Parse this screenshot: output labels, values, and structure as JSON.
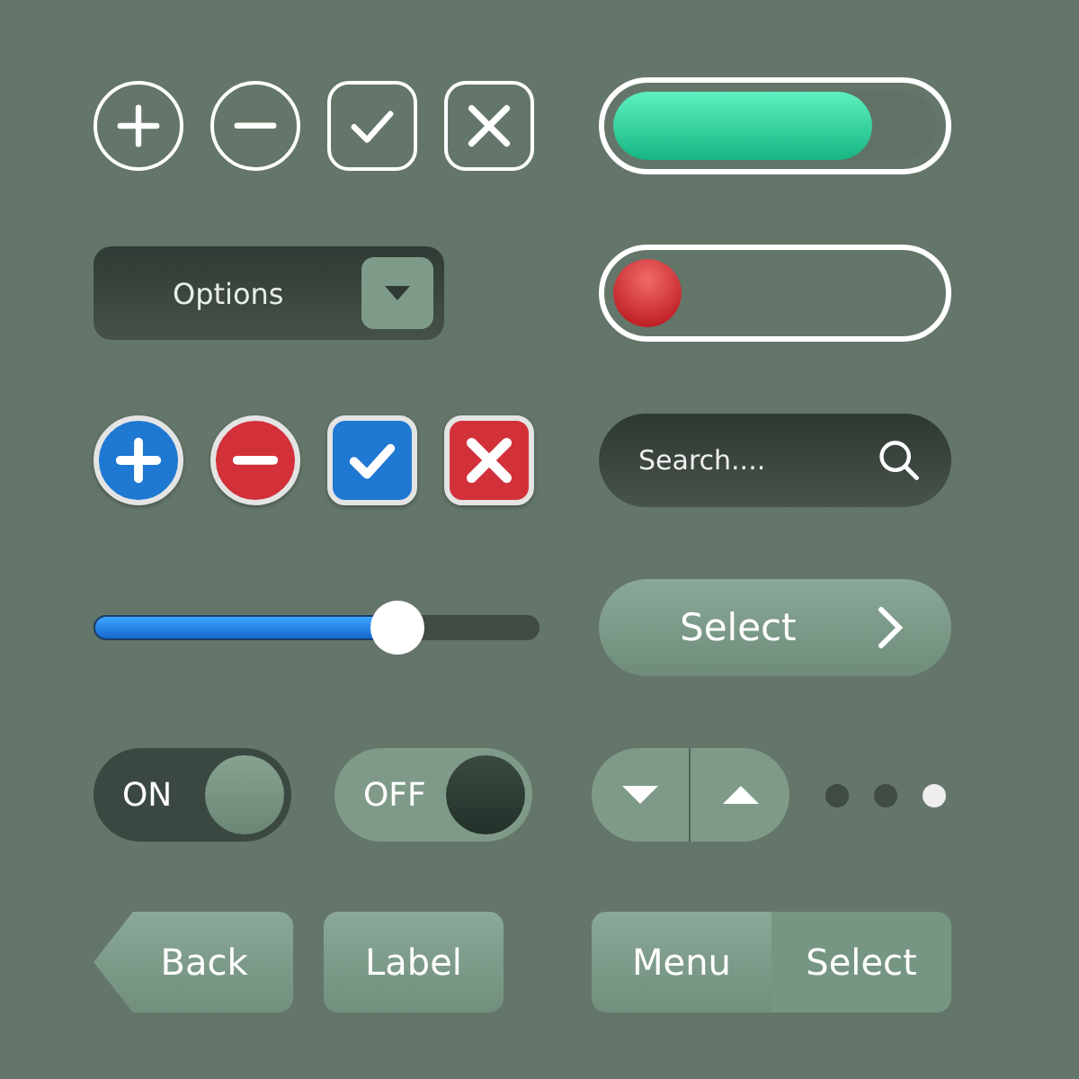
{
  "outline_buttons": [
    {
      "kind": "plus"
    },
    {
      "kind": "minus"
    },
    {
      "kind": "check"
    },
    {
      "kind": "close"
    }
  ],
  "progress_bar": {
    "level": 0.8
  },
  "dropdown": {
    "label": "Options"
  },
  "ball_slider": {
    "level": 0
  },
  "color_buttons": [
    {
      "kind": "plus",
      "color": "#1f78d1"
    },
    {
      "kind": "minus",
      "color": "#d2313a"
    },
    {
      "kind": "check",
      "color": "#1f78d1"
    },
    {
      "kind": "close",
      "color": "#d2313a"
    }
  ],
  "search": {
    "placeholder": "Search...."
  },
  "slider": {
    "level": 0.68
  },
  "select_button": {
    "label": "Select"
  },
  "toggles": [
    {
      "label": "ON",
      "on": true
    },
    {
      "label": "OFF",
      "on": false
    }
  ],
  "stepper": [
    {
      "kind": "down"
    },
    {
      "kind": "up"
    }
  ],
  "page_dots": [
    {
      "selected": false
    },
    {
      "selected": false
    },
    {
      "selected": true
    }
  ],
  "buttons": [
    {
      "kind": "back",
      "label": "Back"
    },
    {
      "kind": "plain",
      "label": "Label"
    }
  ],
  "segmented": [
    {
      "label": "Menu",
      "selected": false
    },
    {
      "label": "Select",
      "selected": true
    }
  ]
}
